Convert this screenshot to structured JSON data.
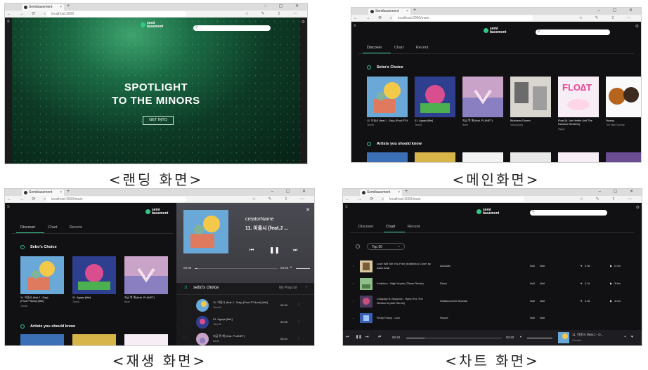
{
  "browser": {
    "tab_title": "Semibasement",
    "tab_title_alt": "Semibasement",
    "url": "localhost:3000",
    "url_main": "localhost:3000/main",
    "new_tab": "+",
    "close": "×"
  },
  "app": {
    "logo_line1": "semi",
    "logo_line2": "basement"
  },
  "landing": {
    "headline_1": "SPOTLIGHT",
    "headline_2": "TO THE MINORS",
    "cta": "GET INTO",
    "caption": "<랜딩 화면>"
  },
  "main": {
    "tabs": [
      "Discover",
      "Chart",
      "Recent"
    ],
    "section1": "Sebo's Choice",
    "section2": "Artists you should know",
    "cards": [
      {
        "title": "11. 이중시 (feat.J - Day) (Prod.P'Skool) [title]",
        "artist": "Tanni2"
      },
      {
        "title": "01. Agape [title]",
        "artist": "Tanni2"
      },
      {
        "title": "지금 뭐 해 (feat. PLANET)",
        "artist": "Blute"
      },
      {
        "title": "Blueberry Dream",
        "artist": "nancy.kang"
      },
      {
        "title": "Float (ft. Joe Hertler And The Rainbow Seekers)",
        "artist": "Hyllyn"
      },
      {
        "title": "Swang",
        "artist": "The High Society"
      }
    ],
    "caption": "<메인화면>"
  },
  "playing": {
    "tabs": [
      "Discover",
      "Chart",
      "Recent"
    ],
    "section1": "Sebo's Choice",
    "section2": "Artists you should know",
    "cards": [
      {
        "title": "11. 이중시 (feat.J - Day) (Prod.P'Skool) [title]",
        "artist": "Tanni2"
      },
      {
        "title": "01. Agape [title]",
        "artist": "Tanni2"
      },
      {
        "title": "지금 뭐 해 (feat. PLANET)",
        "artist": "Blute"
      }
    ],
    "overlay": {
      "creator": "creatorName",
      "track": "11. 이중시 (feat.J ...",
      "time_current": "00:06",
      "time_total": "03:40",
      "progress": 0.03,
      "playlist_name": "sebo's choice",
      "my_playlist": "My PlayList",
      "items": [
        {
          "title": "11. 이중시 (feat.J - Day) (Prod.P'Skool) [title]",
          "artist": "Tanni2",
          "duration": "03:40"
        },
        {
          "title": "01. Agape [title]",
          "artist": "Tanni2",
          "duration": "03:05"
        },
        {
          "title": "지금 뭐 해 (feat. PLANET)",
          "artist": "Blute",
          "duration": "03:24"
        }
      ]
    },
    "caption": "<재생 화면>"
  },
  "chart": {
    "tabs": [
      "Discover",
      "Chart",
      "Recent"
    ],
    "select": "Top 50",
    "rows": [
      {
        "rank": "1",
        "title": "Love Will Set You Free (Kedelino) Cover by Aasir Ariaf",
        "genre": "Acoustic",
        "n1": "Null",
        "n2": "Null",
        "likes": "3.0k",
        "plays": "2.0m"
      },
      {
        "rank": "2",
        "title": "Kedelino - High Hopes (Tilaus Remix)",
        "genre": "Disco",
        "n1": "Null",
        "n2": "Null",
        "likes": "3.1k",
        "plays": "3.8m"
      },
      {
        "rank": "3",
        "title": "Coldplay ft. Beyoncé - Hymn For The Weekend (Ash Remix)",
        "genre": "Undiscovered Sounds",
        "n1": "Null",
        "n2": "Null",
        "likes": "3.2k",
        "plays": "4.0m"
      },
      {
        "rank": "4",
        "title": "Richy Fancy - Low",
        "genre": "House",
        "n1": "Null",
        "n2": "Null",
        "likes": "",
        "plays": ""
      }
    ],
    "player": {
      "time_current": "00:42",
      "time_total": "03:40",
      "progress": 0.19,
      "track": "11. 이중시 (feat.J - D...",
      "artist": "Creator"
    },
    "caption": "<차트 화면>"
  },
  "colors": {
    "accent": "#35c788",
    "app_bg": "#111114",
    "landing_green": "#1b6b45"
  }
}
